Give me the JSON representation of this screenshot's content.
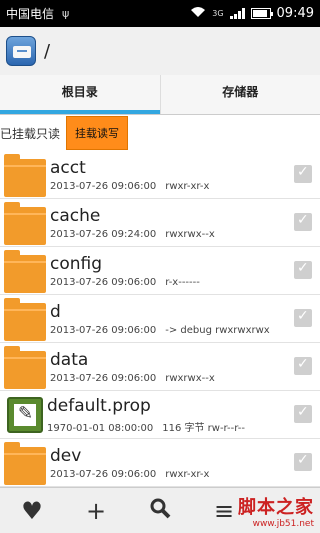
{
  "status": {
    "carrier": "中国电信",
    "usb": "ψ",
    "network": "3G",
    "time": "09:49"
  },
  "titlebar": {
    "path": "/"
  },
  "tabs": [
    {
      "label": "根目录"
    },
    {
      "label": "存储器"
    }
  ],
  "mount": {
    "label": "已挂载只读",
    "button": "挂载读写"
  },
  "files": [
    {
      "name": "acct",
      "date": "2013-07-26 09:06:00",
      "perm": "rwxr-xr-x",
      "type": "folder"
    },
    {
      "name": "cache",
      "date": "2013-07-26 09:24:00",
      "perm": "rwxrwx--x",
      "type": "folder"
    },
    {
      "name": "config",
      "date": "2013-07-26 09:06:00",
      "perm": "r-x------",
      "type": "folder"
    },
    {
      "name": "d",
      "date": "2013-07-26 09:06:00",
      "perm": "-> debug  rwxrwxrwx",
      "type": "folder"
    },
    {
      "name": "data",
      "date": "2013-07-26 09:06:00",
      "perm": "rwxrwx--x",
      "type": "folder"
    },
    {
      "name": "default.prop",
      "date": "1970-01-01 08:00:00",
      "perm": "116 字节  rw-r--r--",
      "type": "file"
    },
    {
      "name": "dev",
      "date": "2013-07-26 09:06:00",
      "perm": "rwxr-xr-x",
      "type": "folder"
    }
  ],
  "toolbar": {
    "heart": "♥",
    "add": "+",
    "search": "🔍",
    "menu": "≡"
  },
  "watermark": {
    "line1": "脚本之家",
    "line2": "www.jb51.net"
  }
}
